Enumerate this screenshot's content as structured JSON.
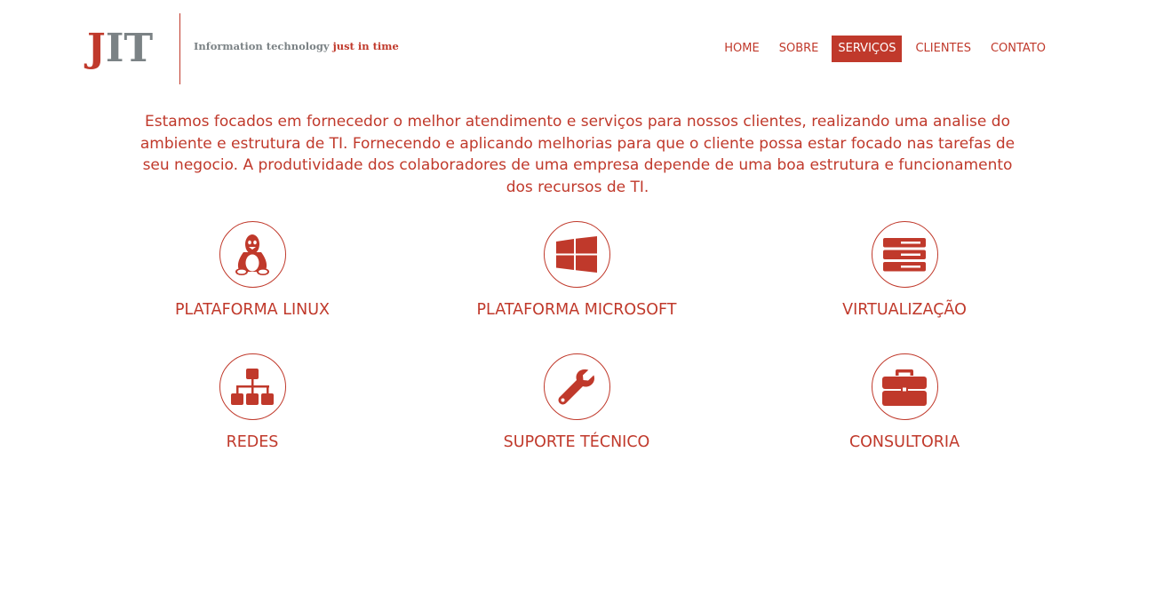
{
  "header": {
    "logo": {
      "j": "J",
      "it": "IT"
    },
    "tagline": {
      "main": "Information technology",
      "accent": "just in time"
    },
    "nav": [
      {
        "label": "HOME",
        "active": false
      },
      {
        "label": "SOBRE",
        "active": false
      },
      {
        "label": "SERVIÇOS",
        "active": true
      },
      {
        "label": "CLIENTES",
        "active": false
      },
      {
        "label": "CONTATO",
        "active": false
      }
    ]
  },
  "intro": {
    "text": "Estamos focados em fornecedor o melhor atendimento e serviços para nossos clientes, realizando uma analise do ambiente e estrutura de TI. Fornecendo e aplicando melhorias para que o cliente possa estar focado nas tarefas de seu negocio. A produtividade dos colaboradores de uma empresa depende de uma boa estrutura e funcionamento dos recursos de TI."
  },
  "services": [
    {
      "label": "PLATAFORMA LINUX",
      "icon": "linux-tux-icon"
    },
    {
      "label": "PLATAFORMA MICROSOFT",
      "icon": "windows-icon"
    },
    {
      "label": "VIRTUALIZAÇÃO",
      "icon": "server-stack-icon"
    },
    {
      "label": "REDES",
      "icon": "network-tree-icon"
    },
    {
      "label": "SUPORTE TÉCNICO",
      "icon": "wrench-icon"
    },
    {
      "label": "CONSULTORIA",
      "icon": "briefcase-icon"
    }
  ],
  "colors": {
    "accent": "#c0392b",
    "logo_gray": "#7b8285",
    "background": "#ffffff"
  }
}
